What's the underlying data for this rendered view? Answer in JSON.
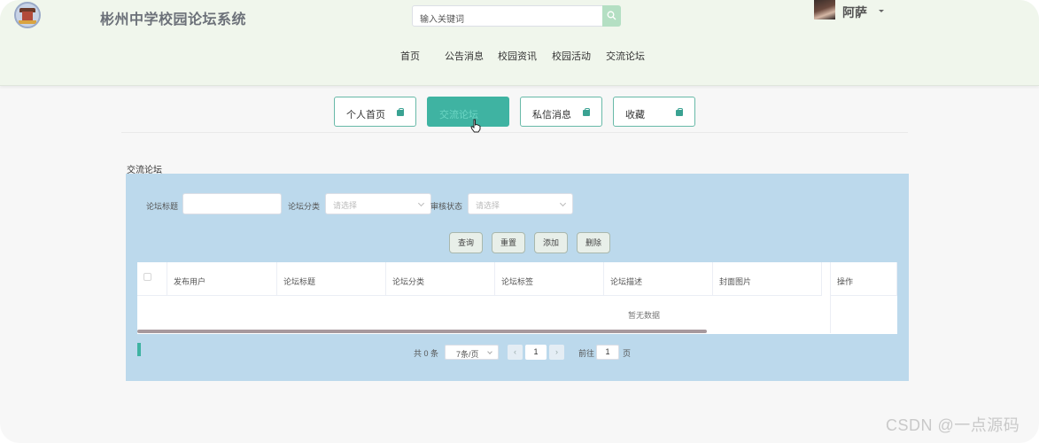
{
  "header": {
    "site_title": "彬州中学校园论坛系统",
    "search_placeholder": "输入关键词",
    "username": "阿萨"
  },
  "nav": [
    "首页",
    "公告消息",
    "校园资讯",
    "校园活动",
    "交流论坛"
  ],
  "cards": [
    {
      "label": "个人首页",
      "active": false
    },
    {
      "label": "交流论坛",
      "active": true
    },
    {
      "label": "私信消息",
      "active": false
    },
    {
      "label": "收藏",
      "active": false
    }
  ],
  "section": {
    "title": "交流论坛"
  },
  "filters": {
    "title_label": "论坛标题",
    "title_value": "",
    "category_label": "论坛分类",
    "category_placeholder": "请选择",
    "status_label": "审核状态",
    "status_placeholder": "请选择"
  },
  "buttons": {
    "query": "查询",
    "reset": "重置",
    "add": "添加",
    "delete": "删除"
  },
  "table": {
    "columns": [
      "发布用户",
      "论坛标题",
      "论坛分类",
      "论坛标签",
      "论坛描述",
      "封面图片",
      "操作"
    ],
    "empty_text": "暂无数据"
  },
  "pagination": {
    "total": "共 0 条",
    "page_size": "7条/页",
    "current_page": "1",
    "goto_label": "前往",
    "goto_value": "1",
    "page_suffix": "页"
  },
  "watermark": "CSDN @一点源码",
  "colors": {
    "accent": "#3fb3a2",
    "panel": "#bcd9ec",
    "header": "#f0f6ec"
  }
}
